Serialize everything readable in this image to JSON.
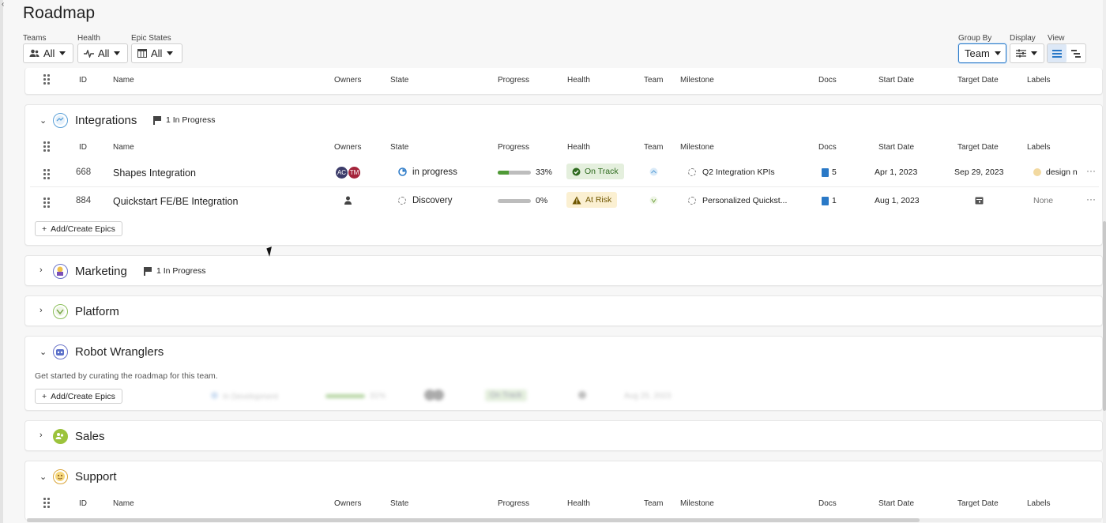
{
  "page": {
    "title": "Roadmap"
  },
  "filters": {
    "teams": {
      "label": "Teams",
      "value": "All"
    },
    "health": {
      "label": "Health",
      "value": "All"
    },
    "epic_states": {
      "label": "Epic States",
      "value": "All"
    },
    "group_by": {
      "label": "Group By",
      "value": "Team"
    },
    "display": {
      "label": "Display"
    },
    "view": {
      "label": "View"
    }
  },
  "columns": {
    "id": "ID",
    "name": "Name",
    "owners": "Owners",
    "state": "State",
    "progress": "Progress",
    "health": "Health",
    "team": "Team",
    "milestone": "Milestone",
    "docs": "Docs",
    "start_date": "Start Date",
    "target_date": "Target Date",
    "labels": "Labels"
  },
  "groups": {
    "integrations": {
      "name": "Integrations",
      "badge": "1 In Progress",
      "rows": [
        {
          "id": "668",
          "name": "Shapes Integration",
          "owners": [
            "AC",
            "TM"
          ],
          "state": "in progress",
          "progress": 0.33,
          "progress_text": "33%",
          "health": "On Track",
          "milestone": "Q2 Integration KPIs",
          "docs": "5",
          "start": "Apr 1, 2023",
          "target": "Sep 29, 2023",
          "label": "design n"
        },
        {
          "id": "884",
          "name": "Quickstart FE/BE Integration",
          "state": "Discovery",
          "progress": 0,
          "progress_text": "0%",
          "health": "At Risk",
          "milestone": "Personalized Quickst...",
          "docs": "1",
          "start": "Aug 1, 2023",
          "label": "None"
        }
      ],
      "add": "Add/Create Epics"
    },
    "marketing": {
      "name": "Marketing",
      "badge": "1 In Progress"
    },
    "platform": {
      "name": "Platform"
    },
    "robot_wranglers": {
      "name": "Robot Wranglers",
      "empty_text": "Get started by curating the roadmap for this team.",
      "add": "Add/Create Epics",
      "ghost": {
        "state": "In Development",
        "progress": "31%",
        "health": "On Track",
        "date": "Aug 25, 2023"
      }
    },
    "sales": {
      "name": "Sales"
    },
    "support": {
      "name": "Support"
    }
  },
  "colors": {
    "accent": "#2a79c7",
    "ok_bg": "#e4efdd",
    "risk_bg": "#fbf0d2",
    "progress": "#4f9a36"
  }
}
